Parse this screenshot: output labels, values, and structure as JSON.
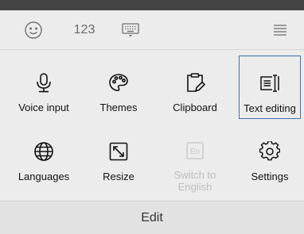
{
  "toolbar": {
    "emoji_icon": "emoji-icon",
    "number_label": "123",
    "keyboard_icon": "keyboard-icon",
    "menu_icon": "menu-icon"
  },
  "grid": {
    "items": [
      {
        "label": "Voice input",
        "icon": "microphone-icon",
        "disabled": false,
        "selected": false
      },
      {
        "label": "Themes",
        "icon": "palette-icon",
        "disabled": false,
        "selected": false
      },
      {
        "label": "Clipboard",
        "icon": "clipboard-icon",
        "disabled": false,
        "selected": false
      },
      {
        "label": "Text editing",
        "icon": "text-editing-icon",
        "disabled": false,
        "selected": true
      },
      {
        "label": "Languages",
        "icon": "globe-icon",
        "disabled": false,
        "selected": false
      },
      {
        "label": "Resize",
        "icon": "resize-icon",
        "disabled": false,
        "selected": false
      },
      {
        "label": "Switch to English",
        "icon": "en-icon",
        "disabled": true,
        "selected": false
      },
      {
        "label": "Settings",
        "icon": "gear-icon",
        "disabled": false,
        "selected": false
      }
    ],
    "en_badge": "En"
  },
  "footer": {
    "title": "Edit"
  },
  "colors": {
    "selection_border": "#3f6ea8",
    "status_bar": "#444444",
    "background": "#ececec"
  }
}
